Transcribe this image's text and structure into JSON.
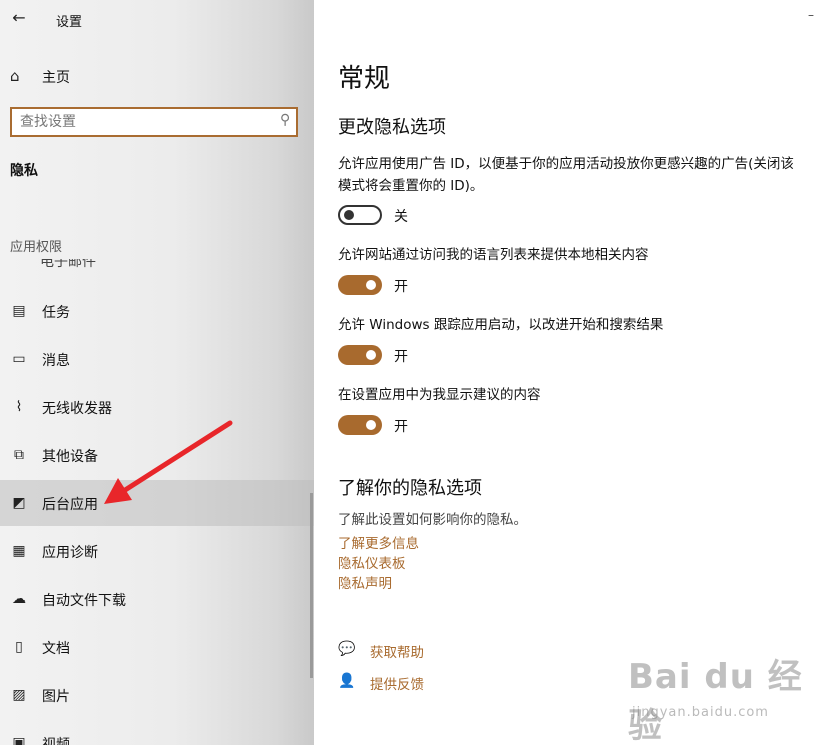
{
  "window": {
    "title": "设置",
    "back_glyph": "←",
    "close_glyph": "–"
  },
  "sidebar": {
    "home_label": "主页",
    "search_placeholder": "查找设置",
    "section_title": "隐私",
    "group_header": "应用权限",
    "partial_item": "电子邮件",
    "items": [
      {
        "label": "任务",
        "icon": "clipboard-icon",
        "glyph": "▤"
      },
      {
        "label": "消息",
        "icon": "chat-icon",
        "glyph": "▭"
      },
      {
        "label": "无线收发器",
        "icon": "antenna-icon",
        "glyph": "⌇"
      },
      {
        "label": "其他设备",
        "icon": "devices-icon",
        "glyph": "⧉"
      },
      {
        "label": "后台应用",
        "icon": "background-apps-icon",
        "glyph": "◩"
      },
      {
        "label": "应用诊断",
        "icon": "diagnostics-icon",
        "glyph": "▦"
      },
      {
        "label": "自动文件下载",
        "icon": "cloud-icon",
        "glyph": "☁"
      },
      {
        "label": "文档",
        "icon": "document-icon",
        "glyph": "▯"
      },
      {
        "label": "图片",
        "icon": "picture-icon",
        "glyph": "▨"
      },
      {
        "label": "视频",
        "icon": "video-icon",
        "glyph": "▣"
      }
    ],
    "active_index": 4
  },
  "main": {
    "title": "常规",
    "section1_title": "更改隐私选项",
    "options": [
      {
        "text": "允许应用使用广告 ID，以便基于你的应用活动投放你更感兴趣的广告(关闭该模式将会重置你的 ID)。",
        "state_label": "关",
        "on": false
      },
      {
        "text": "允许网站通过访问我的语言列表来提供本地相关内容",
        "state_label": "开",
        "on": true
      },
      {
        "text": "允许 Windows 跟踪应用启动，以改进开始和搜索结果",
        "state_label": "开",
        "on": true
      },
      {
        "text": "在设置应用中为我显示建议的内容",
        "state_label": "开",
        "on": true
      }
    ],
    "section2_title": "了解你的隐私选项",
    "section2_sub": "了解此设置如何影响你的隐私。",
    "links": [
      "了解更多信息",
      "隐私仪表板",
      "隐私声明"
    ],
    "help_label": "获取帮助",
    "feedback_label": "提供反馈"
  },
  "watermark": {
    "logo": "Bai du 经验",
    "site": "jingyan.baidu.com"
  },
  "colors": {
    "accent": "#a86a2e",
    "search_border": "#a96c31",
    "arrow": "#e8262a"
  }
}
